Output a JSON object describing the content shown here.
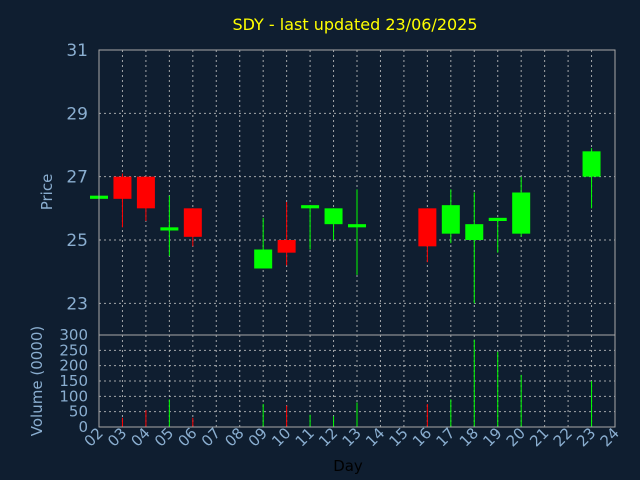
{
  "chart_data": {
    "type": "candlestick",
    "title": "SDY - last updated 23/06/2025",
    "ylabel_price": "Price",
    "ylabel_volume": "Volume (0000)",
    "xlabel": "Day",
    "x_ticks": [
      "02",
      "03",
      "04",
      "05",
      "06",
      "07",
      "08",
      "09",
      "10",
      "11",
      "12",
      "13",
      "14",
      "15",
      "16",
      "17",
      "18",
      "19",
      "20",
      "21",
      "22",
      "23",
      "24"
    ],
    "price_ylim": [
      22,
      31
    ],
    "price_ticks": [
      23,
      25,
      27,
      29,
      31
    ],
    "volume_ylim": [
      0,
      300
    ],
    "volume_ticks": [
      0,
      50,
      100,
      150,
      200,
      250,
      300
    ],
    "colors": {
      "up": "#00ff00",
      "down": "#ff0000"
    },
    "candles": [
      {
        "day": "02",
        "open": 26.3,
        "high": 26.5,
        "low": 26.3,
        "close": 26.4,
        "volume": 0
      },
      {
        "day": "03",
        "open": 27.0,
        "high": 27.1,
        "low": 25.4,
        "close": 26.3,
        "volume": 30
      },
      {
        "day": "04",
        "open": 27.0,
        "high": 27.0,
        "low": 25.6,
        "close": 26.0,
        "volume": 55
      },
      {
        "day": "05",
        "open": 25.3,
        "high": 26.4,
        "low": 24.5,
        "close": 25.4,
        "volume": 90
      },
      {
        "day": "06",
        "open": 26.0,
        "high": 26.0,
        "low": 24.8,
        "close": 25.1,
        "volume": 30
      },
      {
        "day": "09",
        "open": 24.1,
        "high": 25.7,
        "low": 24.1,
        "close": 24.7,
        "volume": 75
      },
      {
        "day": "10",
        "open": 25.0,
        "high": 26.2,
        "low": 24.2,
        "close": 24.6,
        "volume": 70
      },
      {
        "day": "11",
        "open": 26.0,
        "high": 26.1,
        "low": 24.7,
        "close": 26.1,
        "volume": 40
      },
      {
        "day": "12",
        "open": 25.5,
        "high": 26.0,
        "low": 25.0,
        "close": 26.0,
        "volume": 35
      },
      {
        "day": "13",
        "open": 25.4,
        "high": 26.6,
        "low": 23.9,
        "close": 25.5,
        "volume": 80
      },
      {
        "day": "16",
        "open": 26.0,
        "high": 26.0,
        "low": 24.3,
        "close": 24.8,
        "volume": 75
      },
      {
        "day": "17",
        "open": 25.2,
        "high": 26.6,
        "low": 24.9,
        "close": 26.1,
        "volume": 90
      },
      {
        "day": "18",
        "open": 25.0,
        "high": 26.5,
        "low": 23.0,
        "close": 25.5,
        "volume": 285
      },
      {
        "day": "19",
        "open": 25.6,
        "high": 25.7,
        "low": 24.6,
        "close": 25.7,
        "volume": 245
      },
      {
        "day": "20",
        "open": 25.2,
        "high": 27.0,
        "low": 25.1,
        "close": 26.5,
        "volume": 170
      },
      {
        "day": "23",
        "open": 27.0,
        "high": 27.9,
        "low": 26.0,
        "close": 27.8,
        "volume": 150
      }
    ]
  }
}
